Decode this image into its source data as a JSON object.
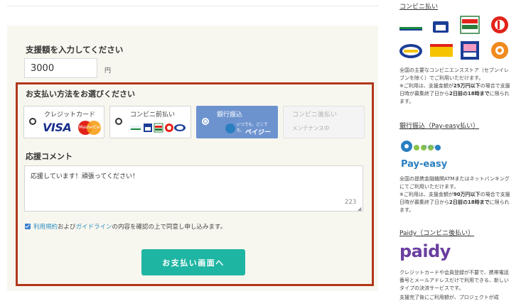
{
  "amount": {
    "title": "支援額を入力してください",
    "value": "3000",
    "unit": "円"
  },
  "payment": {
    "title": "お支払い方法をお選びください",
    "methods": [
      {
        "label": "クレジットカード",
        "selected": false,
        "brands": [
          "VISA",
          "MasterCard"
        ]
      },
      {
        "label": "コンビニ前払い",
        "selected": false
      },
      {
        "label": "銀行振込",
        "selected": true,
        "logo_lines": [
          "いつでも、どこでも、",
          "ペイジー"
        ]
      },
      {
        "label": "コンビニ後払い",
        "selected": false,
        "disabled": true,
        "sub": "メンテナンス中"
      }
    ]
  },
  "comment": {
    "title": "応援コメント",
    "value": "応援しています！頑張ってください！",
    "remaining": "223"
  },
  "agreement": {
    "checked": true,
    "terms_link": "利用規約",
    "and_text": "および",
    "guideline_link": "ガイドライン",
    "rest_text": "の内容を確認の上で同意し申し込みます。"
  },
  "submit_label": "お支払い画面へ",
  "sidebar": {
    "convenience": {
      "link": "コンビニ払い",
      "logo_texts": [
        "FamilyMart",
        "LAWSON",
        "ミニストップ",
        "Daily",
        "スリーエフ"
      ],
      "text1": "全国の主要なコンビニエンスストア（セブンイレブンを除く）でご利用いただけます。",
      "text2_prefix": "※ご利用は、支援金額が",
      "text2_bold1": "25万円以下",
      "text2_mid": "の場合で支援日時が募集終了日から",
      "text2_bold2": "2日前の18時まで",
      "text2_suffix": "に限られます。"
    },
    "bank": {
      "link": "銀行振込（Pay-easy払い）",
      "logo_text": "Pay-easy",
      "logo_small": "ペイジー",
      "text1": "全国の提携金融機関ATMまたはネットバンキングにてご利用いただけます。",
      "text2_prefix": "※ご利用は、支援金額が",
      "text2_bold1": "90万円以下",
      "text2_mid": "の場合で支援日時が募集終了日から",
      "text2_bold2": "2日前の18時まで",
      "text2_suffix": "に限られます。"
    },
    "paidy": {
      "link": "Paidy（コンビニ後払い）",
      "logo_text": "paidy",
      "text1": "クレジットカードや会員登録が不要で、携帯電話番号とメールアドレスだけで利用できる、新しいタイプの決済サービスです。",
      "text2": "支援完了後にご利用額が、プロジェクトが成"
    }
  },
  "colors": {
    "panel_bg": "#f8f7ef",
    "highlight_border": "#b1371a",
    "selected_method": "#6d93cf",
    "submit_button": "#1fb5a3",
    "link": "#2a8ec2"
  }
}
